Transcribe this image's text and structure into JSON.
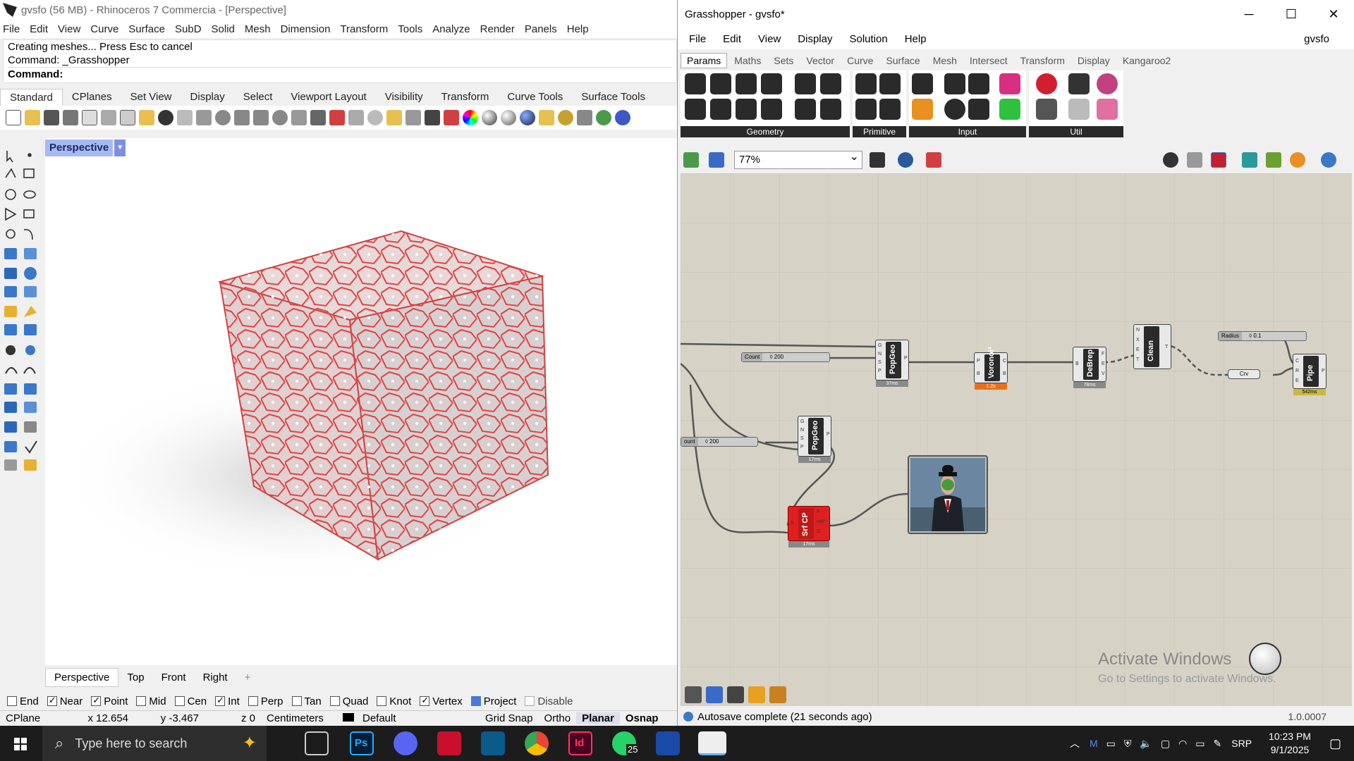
{
  "rhino": {
    "title": "gvsfo (56 MB) - Rhinoceros 7 Commercia - [Perspective]",
    "menu": [
      "File",
      "Edit",
      "View",
      "Curve",
      "Surface",
      "SubD",
      "Solid",
      "Mesh",
      "Dimension",
      "Transform",
      "Tools",
      "Analyze",
      "Render",
      "Panels",
      "Help"
    ],
    "command_history": [
      "Creating meshes... Press Esc to cancel",
      "Command: _Grasshopper"
    ],
    "command_prompt": "Command:",
    "toolbar_tabs": [
      "Standard",
      "CPlanes",
      "Set View",
      "Display",
      "Select",
      "Viewport Layout",
      "Visibility",
      "Transform",
      "Curve Tools",
      "Surface Tools"
    ],
    "viewport_label": "Perspective",
    "viewport_tabs": [
      "Perspective",
      "Top",
      "Front",
      "Right"
    ],
    "viewport_tab_add": "+",
    "osnaps": [
      {
        "label": "End",
        "checked": false
      },
      {
        "label": "Near",
        "checked": true
      },
      {
        "label": "Point",
        "checked": true
      },
      {
        "label": "Mid",
        "checked": false
      },
      {
        "label": "Cen",
        "checked": false
      },
      {
        "label": "Int",
        "checked": true
      },
      {
        "label": "Perp",
        "checked": false
      },
      {
        "label": "Tan",
        "checked": false
      },
      {
        "label": "Quad",
        "checked": false
      },
      {
        "label": "Knot",
        "checked": false
      },
      {
        "label": "Vertex",
        "checked": true
      },
      {
        "label": "Project",
        "checked": true
      },
      {
        "label": "Disable",
        "checked": false
      }
    ],
    "status": {
      "cplane": "CPlane",
      "x": "x 12.654",
      "y": "y -3.467",
      "z": "z 0",
      "units": "Centimeters",
      "layer": "Default",
      "grid_snap": "Grid Snap",
      "ortho": "Ortho",
      "planar": "Planar",
      "osnap": "Osnap"
    },
    "accent_color": "#a8b8f0"
  },
  "grasshopper": {
    "title": "Grasshopper - gvsfo*",
    "menu": [
      "File",
      "Edit",
      "View",
      "Display",
      "Solution",
      "Help"
    ],
    "doc_name": "gvsfo",
    "tabs": [
      "Params",
      "Maths",
      "Sets",
      "Vector",
      "Curve",
      "Surface",
      "Mesh",
      "Intersect",
      "Transform",
      "Display",
      "Kangaroo2"
    ],
    "ribbon_groups": [
      "Geometry",
      "Primitive",
      "Input",
      "Util"
    ],
    "zoom": "77%",
    "components": {
      "count_slider_name": "Count",
      "count_slider_value": "◊ 200",
      "count_slider2_name": "ount",
      "count_slider2_value": "◊ 200",
      "radius_slider_name": "Radius",
      "radius_slider_value": "◊ 0.1",
      "popgeo1": {
        "label": "PopGeo",
        "inputs": [
          "G",
          "N",
          "S",
          "P"
        ],
        "outputs": [
          "P"
        ],
        "time": "37ms"
      },
      "popgeo2": {
        "label": "PopGeo",
        "inputs": [
          "G",
          "N",
          "S",
          "P"
        ],
        "outputs": [
          "P"
        ],
        "time": "17ms"
      },
      "voronoi": {
        "label": "Voronoi³",
        "inputs": [
          "P",
          "B"
        ],
        "outputs": [
          "C",
          "B"
        ],
        "time": "1.2s"
      },
      "debrep": {
        "label": "DeBrep",
        "inputs": [
          "B"
        ],
        "outputs": [
          "F",
          "E",
          "V"
        ],
        "time": "78ms"
      },
      "clean": {
        "label": "Clean",
        "inputs": [
          "N",
          "X",
          "E",
          "T"
        ],
        "outputs": [
          "T"
        ]
      },
      "crv": "Crv",
      "pipe": {
        "label": "Pipe",
        "inputs": [
          "C",
          "R",
          "E"
        ],
        "outputs": [
          "P"
        ],
        "time": "542ms"
      },
      "srfcp": {
        "label": "Srf CP",
        "inputs": [
          "S"
        ],
        "outputs": [
          "P",
          "uvP",
          "D"
        ],
        "time": "17ms"
      }
    },
    "watermark_title": "Activate Windows",
    "watermark_sub": "Go to Settings to activate Windows.",
    "status": "Autosave complete (21 seconds ago)",
    "version": "1.0.0007"
  },
  "taskbar": {
    "search_placeholder": "Type here to search",
    "whatsapp_badge": "25",
    "tray_lang": "SRP",
    "time": "10:23 PM",
    "date": "9/1/2025"
  }
}
